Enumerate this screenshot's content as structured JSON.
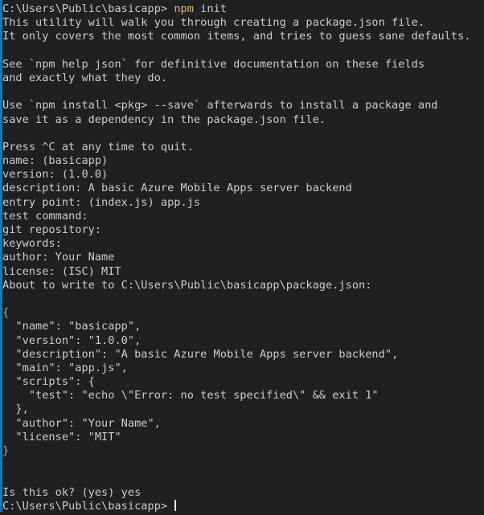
{
  "terminal": {
    "background_color": "#1e2021",
    "foreground_color": "#cccccc",
    "accent_color": "#0e7ac4",
    "command_color": "#d7ba7d",
    "brace_color": "#c8a97e",
    "prompt_path": "C:\\Users\\Public\\basicapp>",
    "cursor": "text-cursor"
  },
  "lines": [
    {
      "id": "l1",
      "type": "prompt",
      "prompt": "C:\\Users\\Public\\basicapp> ",
      "command": "npm",
      "args": " init"
    },
    {
      "id": "l2",
      "type": "output",
      "text": "This utility will walk you through creating a package.json file."
    },
    {
      "id": "l3",
      "type": "output",
      "text": "It only covers the most common items, and tries to guess sane defaults."
    },
    {
      "id": "l4",
      "type": "blank",
      "text": ""
    },
    {
      "id": "l5",
      "type": "output",
      "text": "See `npm help json` for definitive documentation on these fields"
    },
    {
      "id": "l6",
      "type": "output",
      "text": "and exactly what they do."
    },
    {
      "id": "l7",
      "type": "blank",
      "text": ""
    },
    {
      "id": "l8",
      "type": "output",
      "text": "Use `npm install <pkg> --save` afterwards to install a package and"
    },
    {
      "id": "l9",
      "type": "output",
      "text": "save it as a dependency in the package.json file."
    },
    {
      "id": "l10",
      "type": "blank",
      "text": ""
    },
    {
      "id": "l11",
      "type": "output",
      "text": "Press ^C at any time to quit."
    },
    {
      "id": "l12",
      "type": "output",
      "text": "name: (basicapp)"
    },
    {
      "id": "l13",
      "type": "output",
      "text": "version: (1.0.0)"
    },
    {
      "id": "l14",
      "type": "output",
      "text": "description: A basic Azure Mobile Apps server backend"
    },
    {
      "id": "l15",
      "type": "output",
      "text": "entry point: (index.js) app.js"
    },
    {
      "id": "l16",
      "type": "output",
      "text": "test command:"
    },
    {
      "id": "l17",
      "type": "output",
      "text": "git repository:"
    },
    {
      "id": "l18",
      "type": "output",
      "text": "keywords:"
    },
    {
      "id": "l19",
      "type": "output",
      "text": "author: Your Name"
    },
    {
      "id": "l20",
      "type": "output",
      "text": "license: (ISC) MIT"
    },
    {
      "id": "l21",
      "type": "output",
      "text": "About to write to C:\\Users\\Public\\basicapp\\package.json:"
    },
    {
      "id": "l22",
      "type": "blank",
      "text": ""
    },
    {
      "id": "l23",
      "type": "brace",
      "text": "{"
    },
    {
      "id": "l24",
      "type": "output",
      "text": "  \"name\": \"basicapp\","
    },
    {
      "id": "l25",
      "type": "output",
      "text": "  \"version\": \"1.0.0\","
    },
    {
      "id": "l26",
      "type": "output",
      "text": "  \"description\": \"A basic Azure Mobile Apps server backend\","
    },
    {
      "id": "l27",
      "type": "output",
      "text": "  \"main\": \"app.js\","
    },
    {
      "id": "l28",
      "type": "output",
      "text": "  \"scripts\": {"
    },
    {
      "id": "l29",
      "type": "output",
      "text": "    \"test\": \"echo \\\"Error: no test specified\\\" && exit 1\""
    },
    {
      "id": "l30",
      "type": "output",
      "text": "  },"
    },
    {
      "id": "l31",
      "type": "output",
      "text": "  \"author\": \"Your Name\","
    },
    {
      "id": "l32",
      "type": "output",
      "text": "  \"license\": \"MIT\""
    },
    {
      "id": "l33",
      "type": "brace",
      "text": "}"
    },
    {
      "id": "l34",
      "type": "blank",
      "text": ""
    },
    {
      "id": "l35",
      "type": "blank",
      "text": ""
    },
    {
      "id": "l36",
      "type": "output",
      "text": "Is this ok? (yes) yes"
    },
    {
      "id": "l37",
      "type": "cursorprompt",
      "prompt": "C:\\Users\\Public\\basicapp> "
    }
  ]
}
